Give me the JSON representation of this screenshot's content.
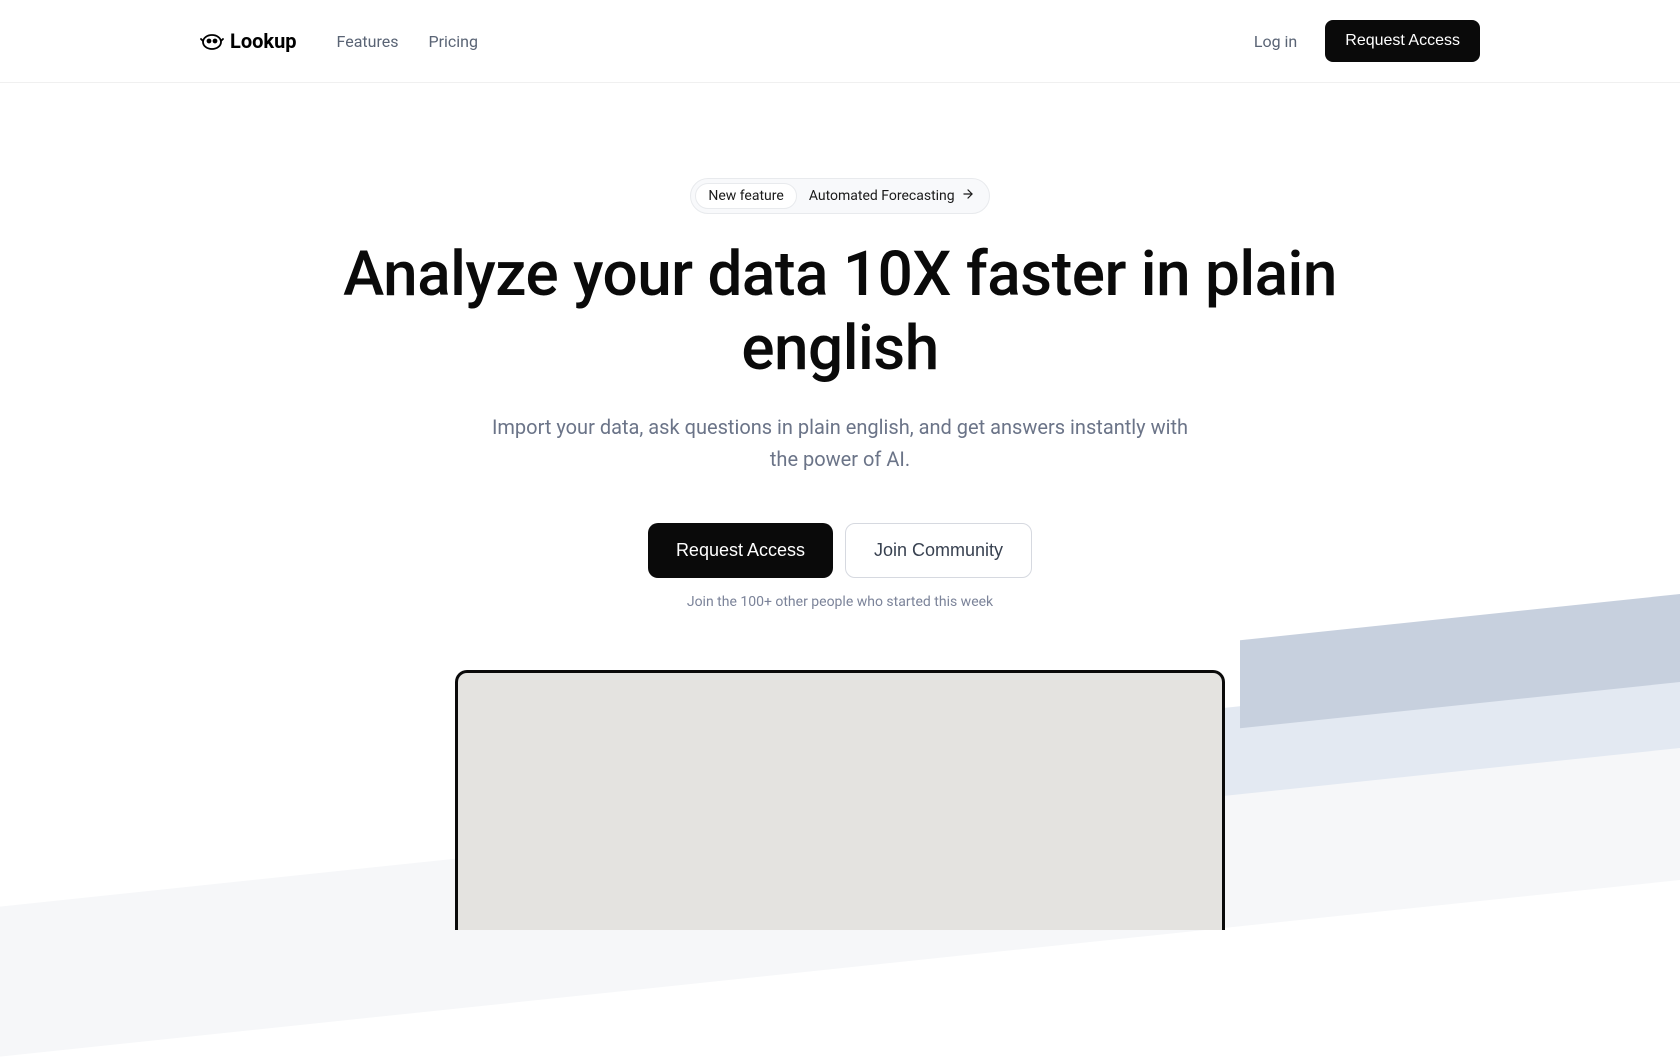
{
  "header": {
    "logo_text": "Lookup",
    "nav": {
      "features": "Features",
      "pricing": "Pricing"
    },
    "login": "Log in",
    "request_access": "Request Access"
  },
  "hero": {
    "badge_new": "New feature",
    "badge_text": "Automated Forecasting",
    "title": "Analyze your data 10X faster in plain english",
    "subtitle": "Import your data, ask questions in plain english, and get answers instantly with the power of AI.",
    "primary_button": "Request Access",
    "secondary_button": "Join Community",
    "caption": "Join the 100+ other people who started this week"
  }
}
